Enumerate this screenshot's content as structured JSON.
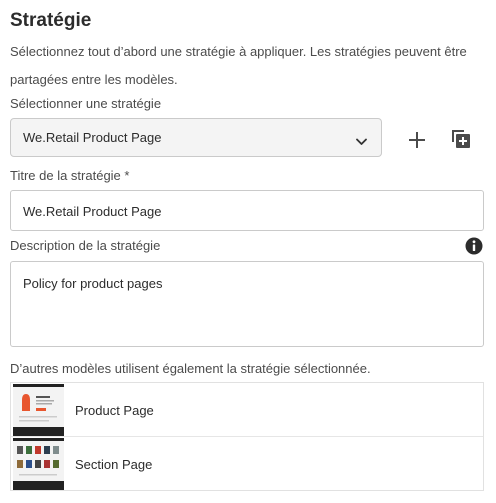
{
  "panel": {
    "title": "Stratégie",
    "description": "Sélectionnez tout d’abord une stratégie à appliquer. Les stratégies peuvent être partagées entre les modèles."
  },
  "select_policy": {
    "label": "Sélectionner une stratégie",
    "value": "We.Retail Product Page",
    "add_icon": "plus-icon",
    "duplicate_icon": "duplicate-icon"
  },
  "policy_title": {
    "label": "Titre de la stratégie *",
    "value": "We.Retail Product Page"
  },
  "policy_description": {
    "label": "Description de la stratégie",
    "info_icon": "info-icon",
    "value": "Policy for product pages"
  },
  "used_by": {
    "label": "D’autres modèles utilisent également la stratégie sélectionnée.",
    "templates": [
      {
        "name": "Product Page"
      },
      {
        "name": "Section Page"
      }
    ]
  }
}
